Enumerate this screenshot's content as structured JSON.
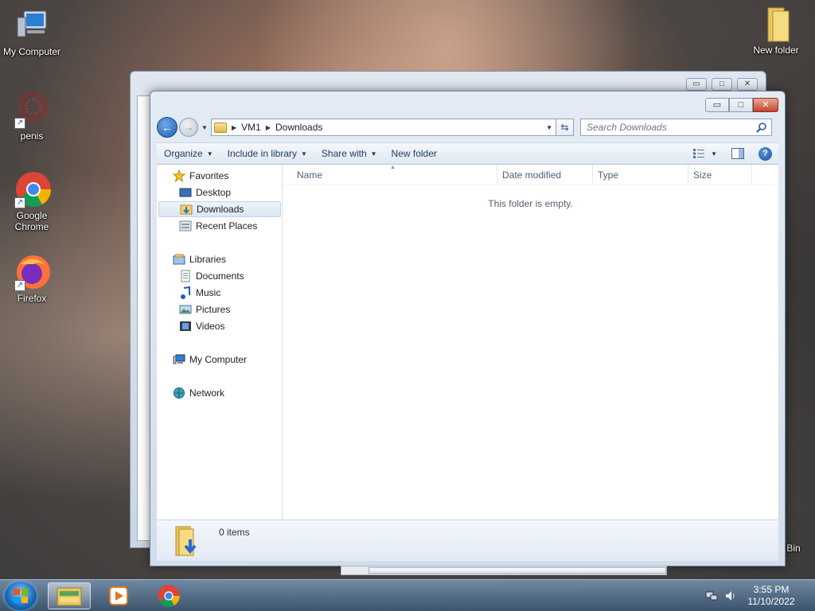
{
  "desktop": {
    "icons": [
      {
        "label": "My Computer"
      },
      {
        "label": "penis"
      },
      {
        "label": "Google Chrome"
      },
      {
        "label": "Firefox"
      },
      {
        "label": "New folder"
      },
      {
        "label": "Bin"
      }
    ]
  },
  "window": {
    "caption_buttons": {
      "minimize": "▭",
      "maximize": "□",
      "close": "✕"
    },
    "address": {
      "crumbs": [
        "VM1",
        "Downloads"
      ]
    },
    "search": {
      "placeholder": "Search Downloads"
    },
    "toolbar": {
      "organize": "Organize",
      "include_in_library": "Include in library",
      "share_with": "Share with",
      "new_folder": "New folder"
    },
    "sidebar": {
      "favorites": {
        "label": "Favorites",
        "items": [
          "Desktop",
          "Downloads",
          "Recent Places"
        ]
      },
      "libraries": {
        "label": "Libraries",
        "items": [
          "Documents",
          "Music",
          "Pictures",
          "Videos"
        ]
      },
      "my_computer": "My Computer",
      "network": "Network",
      "selected": "Downloads"
    },
    "columns": [
      "Name",
      "Date modified",
      "Type",
      "Size"
    ],
    "empty_message": "This folder is empty.",
    "details": {
      "item_count": "0 items"
    }
  },
  "taskbar": {
    "clock": {
      "time": "3:55 PM",
      "date": "11/10/2022"
    }
  },
  "colors": {
    "accent": "#1f5fb0",
    "selection": "#dbe6f3",
    "close_button": "#c7432c"
  }
}
